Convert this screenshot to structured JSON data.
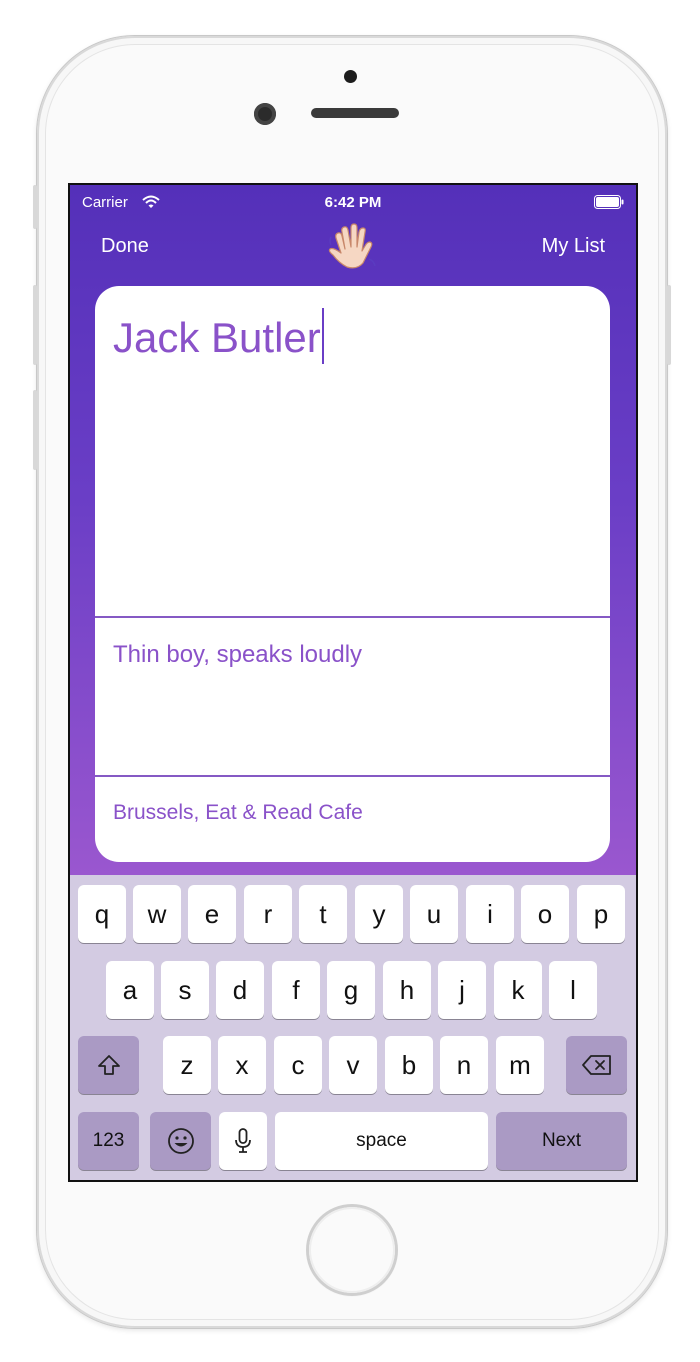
{
  "status_bar": {
    "carrier": "Carrier",
    "time": "6:42 PM",
    "wifi_icon": "wifi-icon",
    "battery_icon": "battery-icon"
  },
  "nav": {
    "done_label": "Done",
    "my_list_label": "My List",
    "center_icon": "waving-hand-icon"
  },
  "form": {
    "name_value": "Jack Butler",
    "description_value": "Thin boy, speaks loudly",
    "place_value": "Brussels, Eat & Read Cafe"
  },
  "keyboard": {
    "row1": [
      "q",
      "w",
      "e",
      "r",
      "t",
      "y",
      "u",
      "i",
      "o",
      "p"
    ],
    "row2": [
      "a",
      "s",
      "d",
      "f",
      "g",
      "h",
      "j",
      "k",
      "l"
    ],
    "row3": [
      "z",
      "x",
      "c",
      "v",
      "b",
      "n",
      "m"
    ],
    "numbers_label": "123",
    "space_label": "space",
    "next_label": "Next",
    "shift_icon": "shift-icon",
    "delete_icon": "delete-icon",
    "emoji_icon": "emoji-icon",
    "mic_icon": "microphone-icon"
  },
  "colors": {
    "gradient_top": "#5430b9",
    "gradient_bottom": "#9a57cf",
    "text_accent": "#8a52c9",
    "keyboard_bg": "#d3cbe2",
    "dark_key": "#aa9ac4"
  }
}
